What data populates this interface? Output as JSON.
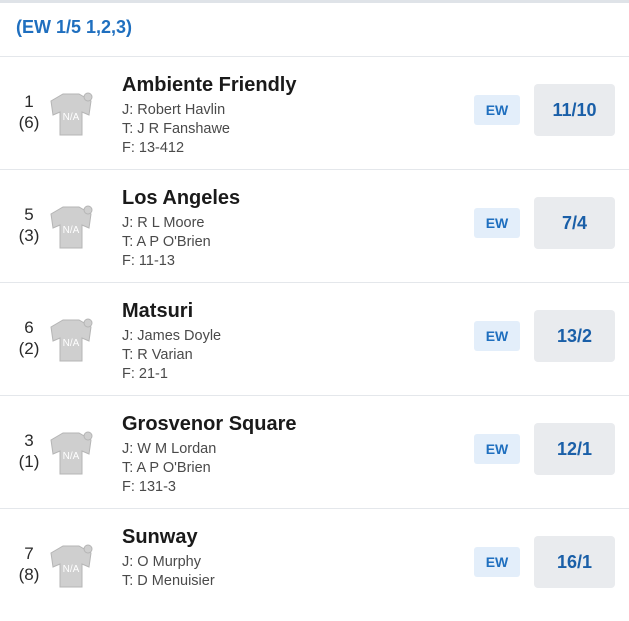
{
  "terms": "(EW 1/5 1,2,3)",
  "silk_placeholder": "N/A",
  "runners": [
    {
      "number": "1",
      "draw": "(6)",
      "name": "Ambiente Friendly",
      "jockey": "J: Robert Havlin",
      "trainer": "T: J R Fanshawe",
      "form": "F: 13-412",
      "ew": "EW",
      "odds": "11/10"
    },
    {
      "number": "5",
      "draw": "(3)",
      "name": "Los Angeles",
      "jockey": "J: R L Moore",
      "trainer": "T: A P O'Brien",
      "form": "F: 11-13",
      "ew": "EW",
      "odds": "7/4"
    },
    {
      "number": "6",
      "draw": "(2)",
      "name": "Matsuri",
      "jockey": "J: James Doyle",
      "trainer": "T: R Varian",
      "form": "F: 21-1",
      "ew": "EW",
      "odds": "13/2"
    },
    {
      "number": "3",
      "draw": "(1)",
      "name": "Grosvenor Square",
      "jockey": "J: W M Lordan",
      "trainer": "T: A P O'Brien",
      "form": "F: 131-3",
      "ew": "EW",
      "odds": "12/1"
    },
    {
      "number": "7",
      "draw": "(8)",
      "name": "Sunway",
      "jockey": "J: O Murphy",
      "trainer": "T: D Menuisier",
      "form": "",
      "ew": "EW",
      "odds": "16/1"
    }
  ]
}
